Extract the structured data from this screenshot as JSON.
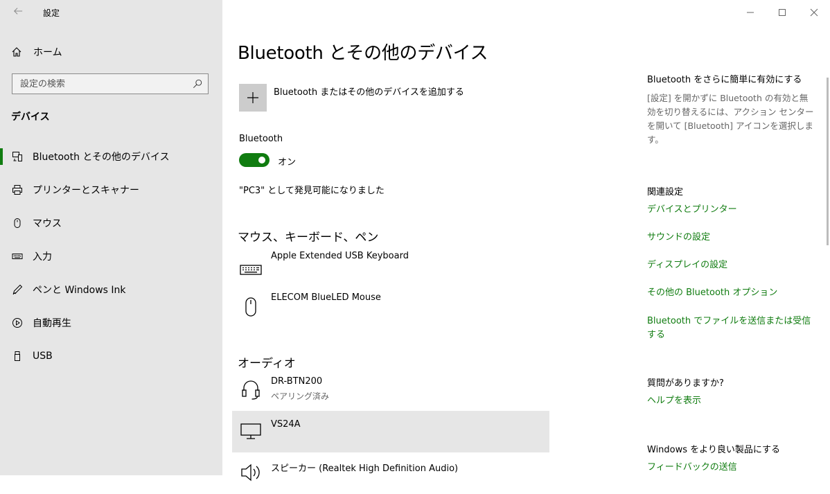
{
  "titlebar": {
    "app_title": "設定"
  },
  "sidebar": {
    "home_label": "ホーム",
    "search_placeholder": "設定の検索",
    "section_label": "デバイス",
    "items": [
      {
        "label": "Bluetooth とその他のデバイス",
        "icon": "bluetooth-devices-icon",
        "active": true
      },
      {
        "label": "プリンターとスキャナー",
        "icon": "printer-icon"
      },
      {
        "label": "マウス",
        "icon": "mouse-icon"
      },
      {
        "label": "入力",
        "icon": "keyboard-icon"
      },
      {
        "label": "ペンと Windows Ink",
        "icon": "pen-icon"
      },
      {
        "label": "自動再生",
        "icon": "autoplay-icon"
      },
      {
        "label": "USB",
        "icon": "usb-icon"
      }
    ]
  },
  "main": {
    "title": "Bluetooth とその他のデバイス",
    "add_device_label": "Bluetooth またはその他のデバイスを追加する",
    "bluetooth_label": "Bluetooth",
    "bluetooth_state": "オン",
    "discoverable_text": "\"PC3\" として発見可能になりました",
    "groups": [
      {
        "title": "マウス、キーボード、ペン",
        "devices": [
          {
            "name": "Apple Extended USB Keyboard",
            "status": "",
            "icon": "keyboard-icon"
          },
          {
            "name": "ELECOM BlueLED Mouse",
            "status": "",
            "icon": "mouse-icon"
          }
        ]
      },
      {
        "title": "オーディオ",
        "devices": [
          {
            "name": "DR-BTN200",
            "status": "ペアリング済み",
            "icon": "headset-icon"
          },
          {
            "name": "VS24A",
            "status": "",
            "icon": "monitor-icon",
            "selected": true
          },
          {
            "name": "スピーカー (Realtek High Definition Audio)",
            "status": "",
            "icon": "speaker-icon"
          }
        ]
      }
    ]
  },
  "right": {
    "tip_title": "Bluetooth をさらに簡単に有効にする",
    "tip_text": "[設定] を開かずに Bluetooth の有効と無効を切り替えるには、アクション センターを開いて [Bluetooth] アイコンを選択します。",
    "related_title": "関連設定",
    "related_links": [
      "デバイスとプリンター",
      "サウンドの設定",
      "ディスプレイの設定",
      "その他の Bluetooth オプション",
      "Bluetooth でファイルを送信または受信する"
    ],
    "question_title": "質問がありますか?",
    "help_link": "ヘルプを表示",
    "improve_title": "Windows をより良い製品にする",
    "feedback_link": "フィードバックの送信"
  },
  "colors": {
    "accent": "#107c10",
    "sidebar_bg": "#e6e6e6"
  }
}
